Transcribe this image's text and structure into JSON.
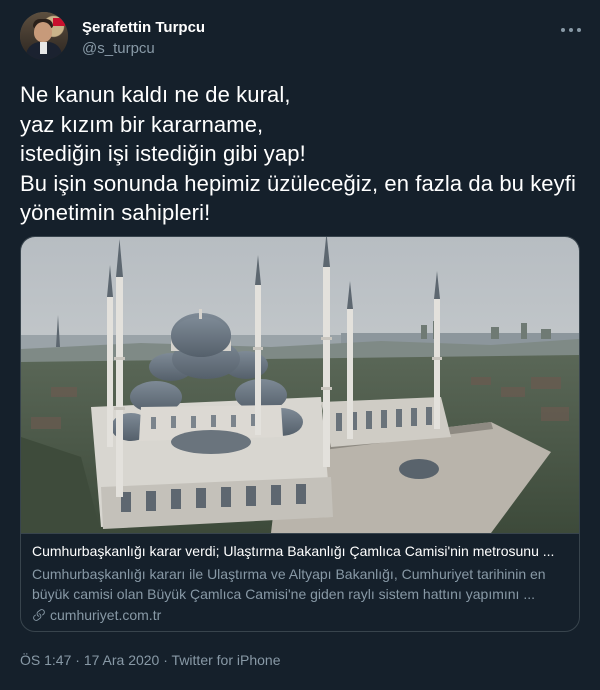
{
  "author": {
    "name": "Şerafettin Turpcu",
    "handle": "@s_turpcu"
  },
  "tweet": {
    "text": "Ne kanun kaldı ne de kural,\nyaz kızım bir kararname,\nistediğin işi istediğin gibi yap!\nBu işin sonunda hepimiz üzüleceğiz, en fazla da bu keyfi yönetimin sahipleri!"
  },
  "card": {
    "title": "Cumhurbaşkanlığı karar verdi; Ulaştırma Bakanlığı Çamlıca Camisi'nin metrosunu ...",
    "description": "Cumhurbaşkanlığı kararı ile Ulaştırma ve Altyapı Bakanlığı, Cumhuriyet tarihinin en büyük camisi olan Büyük Çamlıca Camisi'ne giden raylı sistem hattını yapımını ...",
    "domain": "cumhuriyet.com.tr"
  },
  "meta": {
    "time": "ÖS 1:47",
    "separator1": "·",
    "date": "17 Ara 2020",
    "separator2": "·",
    "source": "Twitter for iPhone"
  },
  "colors": {
    "background": "#15202b",
    "secondary_text": "#8899a6",
    "border": "#38444d"
  },
  "icons": [
    "more-icon",
    "link-icon"
  ]
}
